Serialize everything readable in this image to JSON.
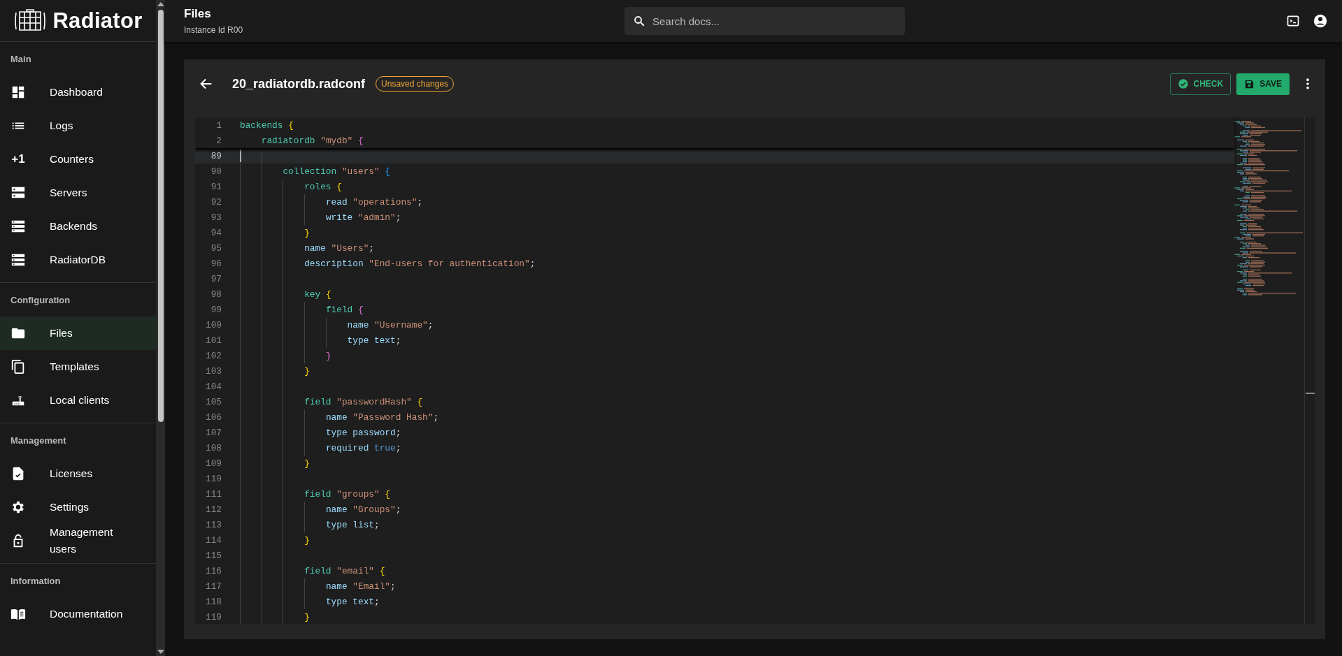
{
  "sidebar": {
    "logo": "Radiator",
    "sections": [
      {
        "title": "Main",
        "items": [
          {
            "label": "Dashboard",
            "selected": false
          },
          {
            "label": "Logs",
            "selected": false
          },
          {
            "label": "Counters",
            "icon_text": "+1",
            "selected": false
          },
          {
            "label": "Servers",
            "selected": false
          },
          {
            "label": "Backends",
            "selected": false
          },
          {
            "label": "RadiatorDB",
            "selected": false
          }
        ]
      },
      {
        "title": "Configuration",
        "items": [
          {
            "label": "Files",
            "selected": true
          },
          {
            "label": "Templates",
            "selected": false
          },
          {
            "label": "Local clients",
            "selected": false
          }
        ]
      },
      {
        "title": "Management",
        "items": [
          {
            "label": "Licenses",
            "selected": false
          },
          {
            "label": "Settings",
            "selected": false
          },
          {
            "label": "Management users",
            "selected": false
          }
        ]
      },
      {
        "title": "Information",
        "items": [
          {
            "label": "Documentation",
            "selected": false
          }
        ]
      }
    ]
  },
  "header": {
    "title": "Files",
    "subtitle": "Instance Id R00",
    "search": {
      "placeholder": "Search docs..."
    }
  },
  "card": {
    "file_name": "20_radiatordb.radconf",
    "badge": "Unsaved changes",
    "buttons": [
      {
        "label": "CHECK",
        "kind": "outlined"
      },
      {
        "label": "SAVE",
        "kind": "filled"
      }
    ]
  },
  "editor": {
    "sticky_lines": [
      {
        "number": "1",
        "tokens": [
          {
            "text": "backends ",
            "kind": "keyword"
          },
          {
            "text": "{",
            "kind": "bracket",
            "color": "#ffd700"
          }
        ]
      },
      {
        "number": "2",
        "tokens": [
          {
            "text": "    radiatordb ",
            "kind": "keyword"
          },
          {
            "text": "\"mydb\" ",
            "kind": "string"
          },
          {
            "text": "{",
            "kind": "bracket",
            "color": "#da70d6"
          }
        ]
      }
    ],
    "lines": [
      {
        "number": "89",
        "current": true
      },
      {
        "number": "90",
        "current": false,
        "tokens": [
          {
            "text": "        collection ",
            "kind": "keyword"
          },
          {
            "text": "\"users\" ",
            "kind": "string"
          },
          {
            "text": "{",
            "kind": "bracket",
            "color": "#179fff"
          }
        ]
      },
      {
        "number": "91",
        "current": false,
        "tokens": [
          {
            "text": "            roles ",
            "kind": "keyword"
          },
          {
            "text": "{",
            "kind": "bracket",
            "color": "#ffd700"
          }
        ]
      },
      {
        "number": "92",
        "current": false,
        "tokens": [
          {
            "text": "                read ",
            "kind": "attribute"
          },
          {
            "text": "\"operations\"",
            "kind": "string"
          },
          {
            "text": ";",
            "kind": "punct"
          }
        ]
      },
      {
        "number": "93",
        "current": false,
        "tokens": [
          {
            "text": "                write ",
            "kind": "attribute"
          },
          {
            "text": "\"admin\"",
            "kind": "string"
          },
          {
            "text": ";",
            "kind": "punct"
          }
        ]
      },
      {
        "number": "94",
        "current": false,
        "tokens": [
          {
            "text": "            }",
            "kind": "bracket",
            "color": "#ffd700"
          }
        ]
      },
      {
        "number": "95",
        "current": false,
        "tokens": [
          {
            "text": "            name ",
            "kind": "attribute"
          },
          {
            "text": "\"Users\"",
            "kind": "string"
          },
          {
            "text": ";",
            "kind": "punct"
          }
        ]
      },
      {
        "number": "96",
        "current": false,
        "tokens": [
          {
            "text": "            description ",
            "kind": "attribute"
          },
          {
            "text": "\"End-users for authentication\"",
            "kind": "string"
          },
          {
            "text": ";",
            "kind": "punct"
          }
        ]
      },
      {
        "number": "97",
        "current": false
      },
      {
        "number": "98",
        "current": false,
        "tokens": [
          {
            "text": "            key ",
            "kind": "keyword"
          },
          {
            "text": "{",
            "kind": "bracket",
            "color": "#ffd700"
          }
        ]
      },
      {
        "number": "99",
        "current": false,
        "tokens": [
          {
            "text": "                field ",
            "kind": "keyword"
          },
          {
            "text": "{",
            "kind": "bracket",
            "color": "#da70d6"
          }
        ]
      },
      {
        "number": "100",
        "current": false,
        "tokens": [
          {
            "text": "                    name ",
            "kind": "attribute"
          },
          {
            "text": "\"Username\"",
            "kind": "string"
          },
          {
            "text": ";",
            "kind": "punct"
          }
        ]
      },
      {
        "number": "101",
        "current": false,
        "tokens": [
          {
            "text": "                    type ",
            "kind": "attribute"
          },
          {
            "text": "text",
            "kind": "value"
          },
          {
            "text": ";",
            "kind": "punct"
          }
        ]
      },
      {
        "number": "102",
        "current": false,
        "tokens": [
          {
            "text": "                }",
            "kind": "bracket",
            "color": "#da70d6"
          }
        ]
      },
      {
        "number": "103",
        "current": false,
        "tokens": [
          {
            "text": "            }",
            "kind": "bracket",
            "color": "#ffd700"
          }
        ]
      },
      {
        "number": "104",
        "current": false
      },
      {
        "number": "105",
        "current": false,
        "tokens": [
          {
            "text": "            field ",
            "kind": "keyword"
          },
          {
            "text": "\"passwordHash\" ",
            "kind": "string"
          },
          {
            "text": "{",
            "kind": "bracket",
            "color": "#ffd700"
          }
        ]
      },
      {
        "number": "106",
        "current": false,
        "tokens": [
          {
            "text": "                name ",
            "kind": "attribute"
          },
          {
            "text": "\"Password Hash\"",
            "kind": "string"
          },
          {
            "text": ";",
            "kind": "punct"
          }
        ]
      },
      {
        "number": "107",
        "current": false,
        "tokens": [
          {
            "text": "                type ",
            "kind": "attribute"
          },
          {
            "text": "password",
            "kind": "value"
          },
          {
            "text": ";",
            "kind": "punct"
          }
        ]
      },
      {
        "number": "108",
        "current": false,
        "tokens": [
          {
            "text": "                required ",
            "kind": "attribute"
          },
          {
            "text": "true",
            "kind": "literal"
          },
          {
            "text": ";",
            "kind": "punct"
          }
        ]
      },
      {
        "number": "109",
        "current": false,
        "tokens": [
          {
            "text": "            }",
            "kind": "bracket",
            "color": "#ffd700"
          }
        ]
      },
      {
        "number": "110",
        "current": false
      },
      {
        "number": "111",
        "current": false,
        "tokens": [
          {
            "text": "            field ",
            "kind": "keyword"
          },
          {
            "text": "\"groups\" ",
            "kind": "string"
          },
          {
            "text": "{",
            "kind": "bracket",
            "color": "#ffd700"
          }
        ]
      },
      {
        "number": "112",
        "current": false,
        "tokens": [
          {
            "text": "                name ",
            "kind": "attribute"
          },
          {
            "text": "\"Groups\"",
            "kind": "string"
          },
          {
            "text": ";",
            "kind": "punct"
          }
        ]
      },
      {
        "number": "113",
        "current": false,
        "tokens": [
          {
            "text": "                type ",
            "kind": "attribute"
          },
          {
            "text": "list",
            "kind": "value"
          },
          {
            "text": ";",
            "kind": "punct"
          }
        ]
      },
      {
        "number": "114",
        "current": false,
        "tokens": [
          {
            "text": "            }",
            "kind": "bracket",
            "color": "#ffd700"
          }
        ]
      },
      {
        "number": "115",
        "current": false
      },
      {
        "number": "116",
        "current": false,
        "tokens": [
          {
            "text": "            field ",
            "kind": "keyword"
          },
          {
            "text": "\"email\" ",
            "kind": "string"
          },
          {
            "text": "{",
            "kind": "bracket",
            "color": "#ffd700"
          }
        ]
      },
      {
        "number": "117",
        "current": false,
        "tokens": [
          {
            "text": "                name ",
            "kind": "attribute"
          },
          {
            "text": "\"Email\"",
            "kind": "string"
          },
          {
            "text": ";",
            "kind": "punct"
          }
        ]
      },
      {
        "number": "118",
        "current": false,
        "tokens": [
          {
            "text": "                type ",
            "kind": "attribute"
          },
          {
            "text": "text",
            "kind": "value"
          },
          {
            "text": ";",
            "kind": "punct"
          }
        ]
      },
      {
        "number": "119",
        "current": false,
        "tokens": [
          {
            "text": "            }",
            "kind": "bracket",
            "color": "#ffd700"
          }
        ]
      }
    ]
  }
}
